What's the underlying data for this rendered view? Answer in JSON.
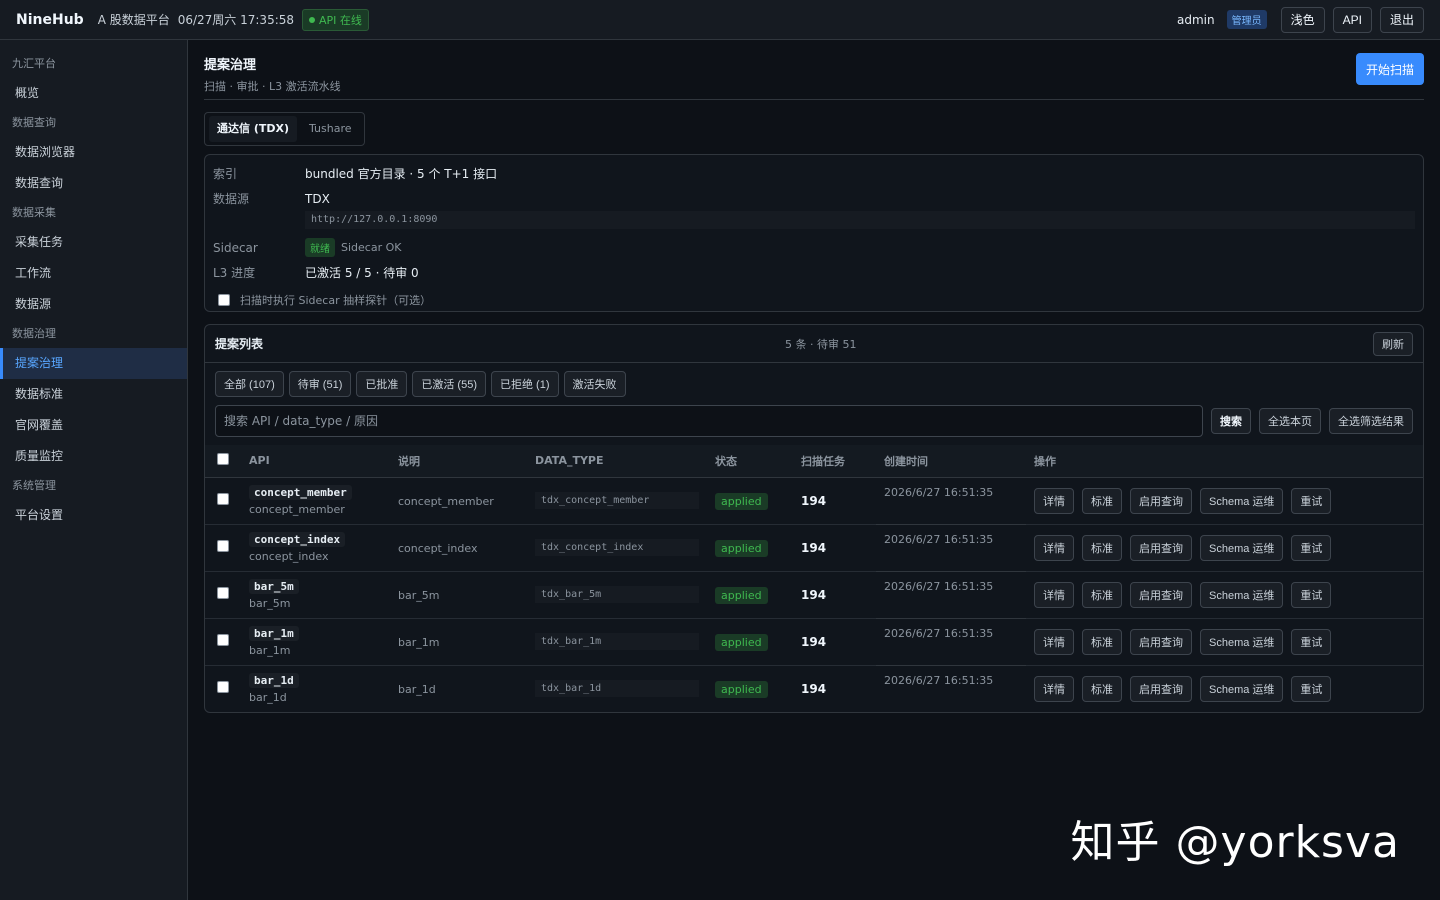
{
  "topbar": {
    "brand": "NineHub",
    "subtitle": "A 股数据平台",
    "clock": "06/27周六 17:35:58",
    "api_status": "API 在线",
    "user": "admin",
    "role": "管理员",
    "theme_btn": "浅色",
    "api_btn": "API",
    "logout_btn": "退出"
  },
  "sidebar": {
    "groups": [
      {
        "label": "九汇平台",
        "items": [
          "概览"
        ]
      },
      {
        "label": "数据查询",
        "items": [
          "数据浏览器",
          "数据查询"
        ]
      },
      {
        "label": "数据采集",
        "items": [
          "采集任务",
          "工作流",
          "数据源"
        ]
      },
      {
        "label": "数据治理",
        "items": [
          "提案治理",
          "数据标准",
          "官网覆盖",
          "质量监控"
        ]
      },
      {
        "label": "系统管理",
        "items": [
          "平台设置"
        ]
      }
    ],
    "active": "提案治理"
  },
  "page": {
    "title": "提案治理",
    "subtitle": "扫描 · 审批 · L3 激活流水线",
    "primary_btn": "开始扫描"
  },
  "source_tabs": [
    "通达信 (TDX)",
    "Tushare"
  ],
  "info": {
    "index_label": "索引",
    "index_val": "bundled 官方目录 · 5 个 T+1 接口",
    "source_label": "数据源",
    "source_val": "TDX",
    "source_url": "http://127.0.0.1:8090",
    "sidecar_label": "Sidecar",
    "sidecar_tag": "就绪",
    "sidecar_text": "Sidecar OK",
    "l3_label": "L3 进度",
    "l3_val": "已激活 5 / 5 · 待审 0",
    "probe_checkbox": "扫描时执行 Sidecar 抽样探针（可选）"
  },
  "list": {
    "title": "提案列表",
    "count": "5 条 · 待审 51",
    "refresh": "刷新",
    "filters": [
      "全部 (107)",
      "待审 (51)",
      "已批准",
      "已激活 (55)",
      "已拒绝 (1)",
      "激活失败"
    ],
    "search_placeholder": "搜索 API / data_type / 原因",
    "search_btn": "搜索",
    "select_page": "全选本页",
    "select_filtered": "全选筛选结果",
    "columns": [
      "API",
      "说明",
      "DATA_TYPE",
      "状态",
      "扫描任务",
      "创建时间",
      "操作"
    ],
    "ops": [
      "详情",
      "标准",
      "启用查询",
      "Schema 运维",
      "重试"
    ],
    "rows": [
      {
        "api": "concept_member",
        "api_sub": "concept_member",
        "desc": "concept_member",
        "dtype": "tdx_concept_member",
        "status": "applied",
        "tasks": "194",
        "created": "2026/6/27 16:51:35"
      },
      {
        "api": "concept_index",
        "api_sub": "concept_index",
        "desc": "concept_index",
        "dtype": "tdx_concept_index",
        "status": "applied",
        "tasks": "194",
        "created": "2026/6/27 16:51:35"
      },
      {
        "api": "bar_5m",
        "api_sub": "bar_5m",
        "desc": "bar_5m",
        "dtype": "tdx_bar_5m",
        "status": "applied",
        "tasks": "194",
        "created": "2026/6/27 16:51:35"
      },
      {
        "api": "bar_1m",
        "api_sub": "bar_1m",
        "desc": "bar_1m",
        "dtype": "tdx_bar_1m",
        "status": "applied",
        "tasks": "194",
        "created": "2026/6/27 16:51:35"
      },
      {
        "api": "bar_1d",
        "api_sub": "bar_1d",
        "desc": "bar_1d",
        "dtype": "tdx_bar_1d",
        "status": "applied",
        "tasks": "194",
        "created": "2026/6/27 16:51:35"
      }
    ]
  },
  "watermark": "知乎 @yorksva"
}
